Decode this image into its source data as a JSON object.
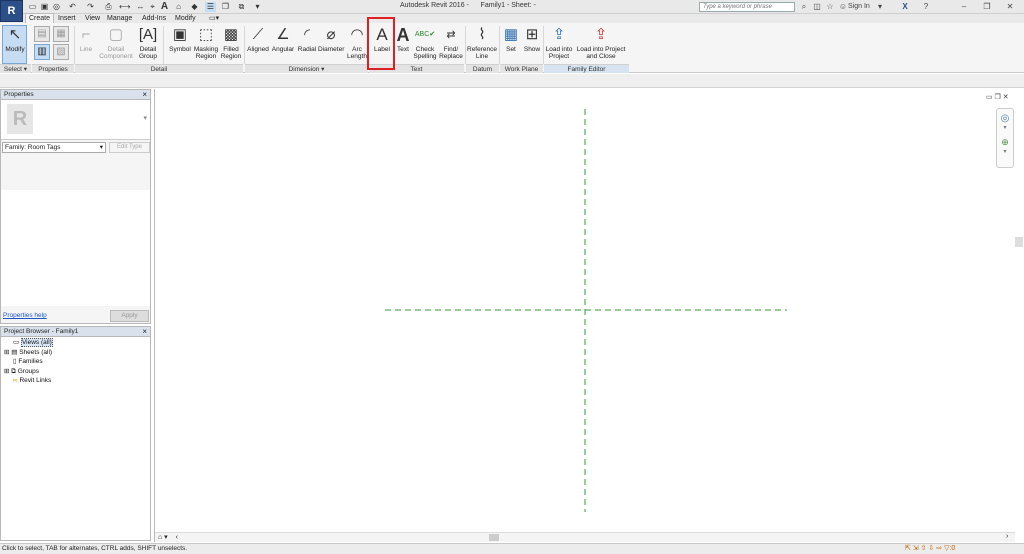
{
  "window": {
    "title": "Autodesk Revit 2016 -      Family1 - Sheet: -"
  },
  "search": {
    "placeholder": "Type a keyword or phrase"
  },
  "user": {
    "sign_in": "Sign In"
  },
  "tabs": [
    "Create",
    "Insert",
    "View",
    "Manage",
    "Add-Ins",
    "Modify"
  ],
  "ribbon": {
    "modify": "Modify",
    "line": "Line",
    "detail_component": "Detail Component",
    "detail_group": "Detail Group",
    "symbol": "Symbol",
    "masking_region": "Masking Region",
    "filled_region": "Filled Region",
    "aligned": "Aligned",
    "angular": "Angular",
    "radial": "Radial",
    "diameter": "Diameter",
    "arc_length": "Arc Length",
    "label": "Label",
    "text": "Text",
    "check_spelling": "Check Spelling",
    "find_replace": "Find/ Replace",
    "reference_line": "Reference Line",
    "set": "Set",
    "show": "Show",
    "load_into_project": "Load into Project",
    "load_into_project_close": "Load into Project and Close"
  },
  "panels": {
    "select": "Select ▾",
    "properties": "Properties",
    "detail": "Detail",
    "dimension": "Dimension ▾",
    "text": "Text",
    "datum": "Datum",
    "work_plane": "Work Plane",
    "family_editor": "Family Editor"
  },
  "annotation": {
    "step": "4"
  },
  "properties_palette": {
    "title": "Properties",
    "type_selector": "Family: Room Tags",
    "edit_type": "Edit Type",
    "help": "Properties help",
    "apply": "Apply"
  },
  "project_browser": {
    "title": "Project Browser - Family1",
    "items": [
      "Views (all)",
      "Sheets (all)",
      "Families",
      "Groups",
      "Revit Links"
    ]
  },
  "status": {
    "text": "Click to select, TAB for alternates, CTRL adds, SHIFT unselects."
  },
  "colors": {
    "accent": "#2b4f86",
    "highlight": "#e02020",
    "reference_plane": "#3a9a3a"
  }
}
